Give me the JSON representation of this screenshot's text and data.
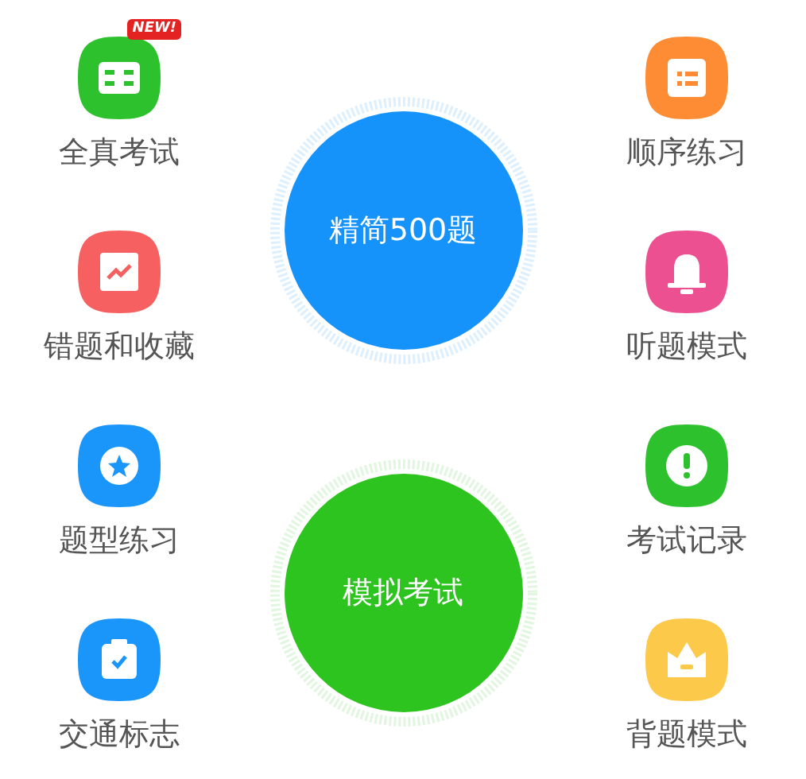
{
  "left_items": [
    {
      "label": "全真考试",
      "kind": "book",
      "color": "#2dc22d",
      "badge": "NEW!"
    },
    {
      "label": "错题和收藏",
      "kind": "chart",
      "color": "#f66060"
    },
    {
      "label": "题型练习",
      "kind": "star",
      "color": "#1a96fa"
    },
    {
      "label": "交通标志",
      "kind": "clipboard",
      "color": "#1a96fa"
    }
  ],
  "center_buttons": [
    {
      "label": "精简500题",
      "color": "#1593fa"
    },
    {
      "label": "模拟考试",
      "color": "#2ec41f"
    }
  ],
  "right_items": [
    {
      "label": "顺序练习",
      "kind": "list",
      "color": "#fd8c35"
    },
    {
      "label": "听题模式",
      "kind": "bell",
      "color": "#ec5090"
    },
    {
      "label": "考试记录",
      "kind": "alert",
      "color": "#2dc22d"
    },
    {
      "label": "背题模式",
      "kind": "crown",
      "color": "#fdc94a"
    }
  ]
}
